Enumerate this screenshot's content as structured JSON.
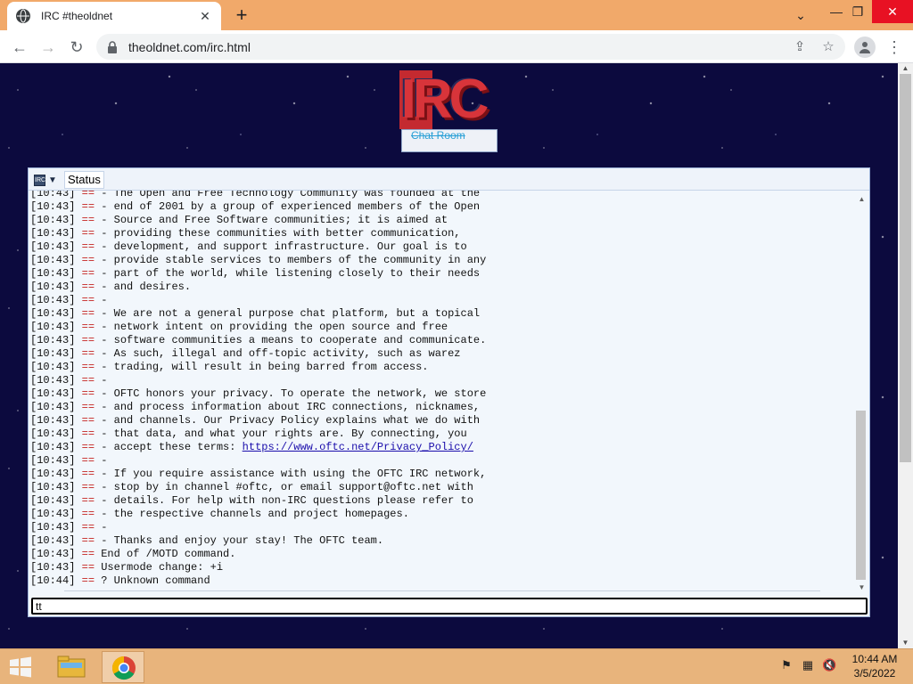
{
  "browser": {
    "tab_title": "IRC #theoldnet",
    "url": "theoldnet.com/irc.html"
  },
  "logo": {
    "title": "IRC",
    "subtitle": "Chat Room"
  },
  "irc": {
    "tab_label": "Status",
    "input_value": "tt",
    "lines": [
      {
        "ts": "[10:43]",
        "mk": "==",
        "text": " - The Open and Free Technology Community was founded at the"
      },
      {
        "ts": "[10:43]",
        "mk": "==",
        "text": " - end of 2001 by a group of experienced members of the Open"
      },
      {
        "ts": "[10:43]",
        "mk": "==",
        "text": " - Source and Free Software communities; it is aimed at"
      },
      {
        "ts": "[10:43]",
        "mk": "==",
        "text": " - providing these communities with better communication,"
      },
      {
        "ts": "[10:43]",
        "mk": "==",
        "text": " - development, and support infrastructure. Our goal is to"
      },
      {
        "ts": "[10:43]",
        "mk": "==",
        "text": " - provide stable services to members of the community in any"
      },
      {
        "ts": "[10:43]",
        "mk": "==",
        "text": " - part of the world, while listening closely to their needs"
      },
      {
        "ts": "[10:43]",
        "mk": "==",
        "text": " - and desires."
      },
      {
        "ts": "[10:43]",
        "mk": "==",
        "text": " -"
      },
      {
        "ts": "[10:43]",
        "mk": "==",
        "text": " - We are not a general purpose chat platform, but a topical"
      },
      {
        "ts": "[10:43]",
        "mk": "==",
        "text": " - network intent on providing the open source and free"
      },
      {
        "ts": "[10:43]",
        "mk": "==",
        "text": " - software communities a means to cooperate and communicate."
      },
      {
        "ts": "[10:43]",
        "mk": "==",
        "text": " - As such, illegal and off-topic activity, such as warez"
      },
      {
        "ts": "[10:43]",
        "mk": "==",
        "text": " - trading, will result in being barred from access."
      },
      {
        "ts": "[10:43]",
        "mk": "==",
        "text": " -"
      },
      {
        "ts": "[10:43]",
        "mk": "==",
        "text": " - OFTC honors your privacy. To operate the network, we store"
      },
      {
        "ts": "[10:43]",
        "mk": "==",
        "text": " - and process information about IRC connections, nicknames,"
      },
      {
        "ts": "[10:43]",
        "mk": "==",
        "text": " - and channels. Our Privacy Policy explains what we do with"
      },
      {
        "ts": "[10:43]",
        "mk": "==",
        "text": " - that data, and what your rights are. By connecting, you"
      },
      {
        "ts": "[10:43]",
        "mk": "==",
        "text": " - accept these terms: ",
        "link": "https://www.oftc.net/Privacy_Policy/"
      },
      {
        "ts": "[10:43]",
        "mk": "==",
        "text": " -"
      },
      {
        "ts": "[10:43]",
        "mk": "==",
        "text": " - If you require assistance with using the OFTC IRC network,"
      },
      {
        "ts": "[10:43]",
        "mk": "==",
        "text": " - stop by in channel #oftc, or email support@oftc.net with"
      },
      {
        "ts": "[10:43]",
        "mk": "==",
        "text": " - details. For help with non-IRC questions please refer to"
      },
      {
        "ts": "[10:43]",
        "mk": "==",
        "text": " - the respective channels and project homepages."
      },
      {
        "ts": "[10:43]",
        "mk": "==",
        "text": " -"
      },
      {
        "ts": "[10:43]",
        "mk": "==",
        "text": " - Thanks and enjoy your stay! The OFTC team."
      },
      {
        "ts": "[10:43]",
        "mk": "==",
        "text": " End of /MOTD command."
      },
      {
        "ts": "[10:43]",
        "mk": "==",
        "text": " Usermode change: +i"
      },
      {
        "ts": "[10:44]",
        "mk": "==",
        "text": " ? Unknown command"
      }
    ]
  },
  "taskbar": {
    "time": "10:44 AM",
    "date": "3/5/2022"
  },
  "colors": {
    "accent": "#f1a96a",
    "irc_marker": "#c4231f",
    "page_bg": "#0c0a3e"
  }
}
